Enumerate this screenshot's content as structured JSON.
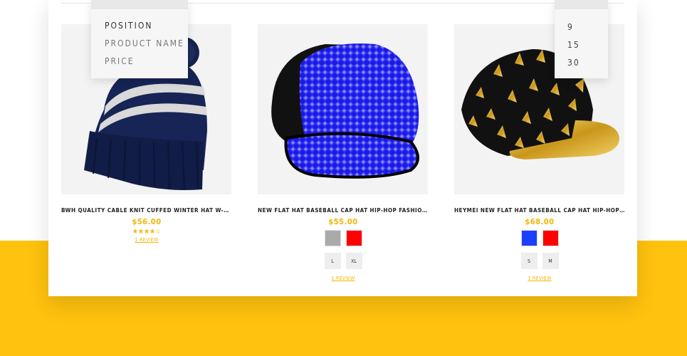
{
  "sort_options": [
    "Position",
    "Product Name",
    "Price"
  ],
  "limit_options": [
    "9",
    "15",
    "30"
  ],
  "products": [
    {
      "name": "BWH Quality Cable Knit Cuffed Winter Hat W-Large Po...",
      "price": "$56.00",
      "rating": "★★★★☆",
      "review": "1 REVIEW",
      "image_icon": "beanie-hat"
    },
    {
      "name": "New Flat Hat Baseball Cap Hat Hip-Hop Fashion Sequi...",
      "price": "$55.00",
      "swatch_colors": [
        "#aaaaaa",
        "#ff0000"
      ],
      "sizes": [
        "L",
        "XL"
      ],
      "review": "1 REVIEW",
      "image_icon": "sequin-cap"
    },
    {
      "name": "Heymei New Flat Hat Baseball Cap Hat Hip-Hop Fashio...",
      "price": "$68.00",
      "swatch_colors": [
        "#1a3fff",
        "#ff0000"
      ],
      "sizes": [
        "S",
        "M"
      ],
      "review": "1 REVIEW",
      "image_icon": "spiked-cap"
    }
  ],
  "colors": {
    "accent": "#ffc20e",
    "price": "#f5b400"
  }
}
